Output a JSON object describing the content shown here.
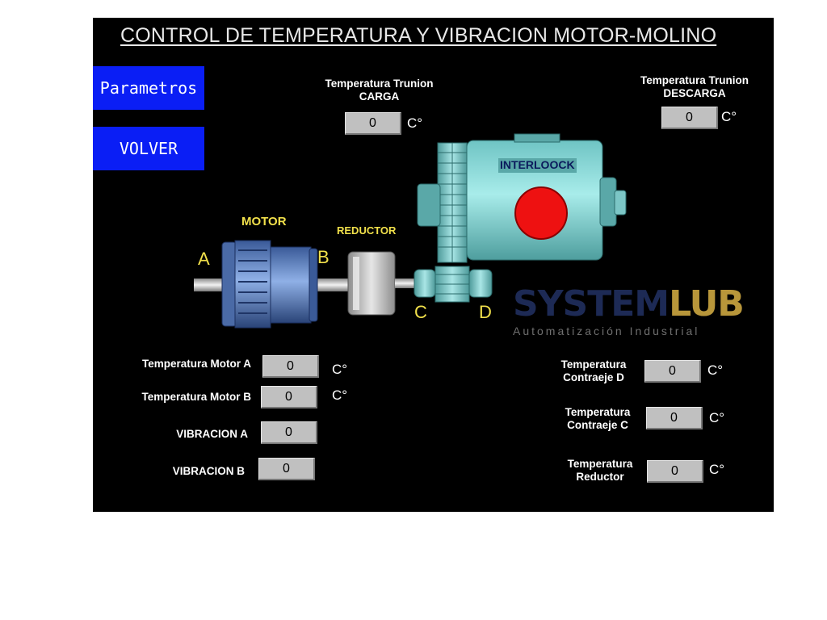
{
  "header": {
    "title": "CONTROL DE TEMPERATURA Y VIBRACION MOTOR-MOLINO"
  },
  "nav": {
    "parametros_label": "Parametros",
    "volver_label": "VOLVER"
  },
  "top": {
    "carga": {
      "label_line1": "Temperatura Trunion",
      "label_line2": "CARGA",
      "value": "0",
      "unit": "C°"
    },
    "descarga": {
      "label_line1": "Temperatura Trunion",
      "label_line2": "DESCARGA",
      "value": "0",
      "unit": "C°"
    }
  },
  "diagram": {
    "motor_label": "MOTOR",
    "reductor_label": "REDUCTOR",
    "interlock_label": "INTERLOOCK",
    "interlock_color": "#ee1111",
    "point_a": "A",
    "point_b": "B",
    "point_c": "C",
    "point_d": "D"
  },
  "left_readings": [
    {
      "label": "Temperatura Motor A",
      "value": "0",
      "unit": "C°"
    },
    {
      "label": "Temperatura Motor B",
      "value": "0",
      "unit": "C°"
    },
    {
      "label": "VIBRACION A",
      "value": "0"
    },
    {
      "label": "VIBRACION B",
      "value": "0"
    }
  ],
  "right_readings": [
    {
      "label_line1": "Temperatura",
      "label_line2": "Contraeje D",
      "value": "0",
      "unit": "C°"
    },
    {
      "label_line1": "Temperatura",
      "label_line2": "Contraeje C",
      "value": "0",
      "unit": "C°"
    },
    {
      "label_line1": "Temperatura",
      "label_line2": "Reductor",
      "value": "0",
      "unit": "C°"
    }
  ],
  "watermark": {
    "name_part1": "SYSTEM",
    "name_part2": "LUB",
    "tagline": "Automatización Industrial"
  },
  "colors": {
    "screen_bg": "#000000",
    "button_blue": "#0a1ef5",
    "label_yellow": "#f1e04b",
    "field_gray": "#c0c0c0",
    "mill_teal": "#8ed8d8"
  }
}
